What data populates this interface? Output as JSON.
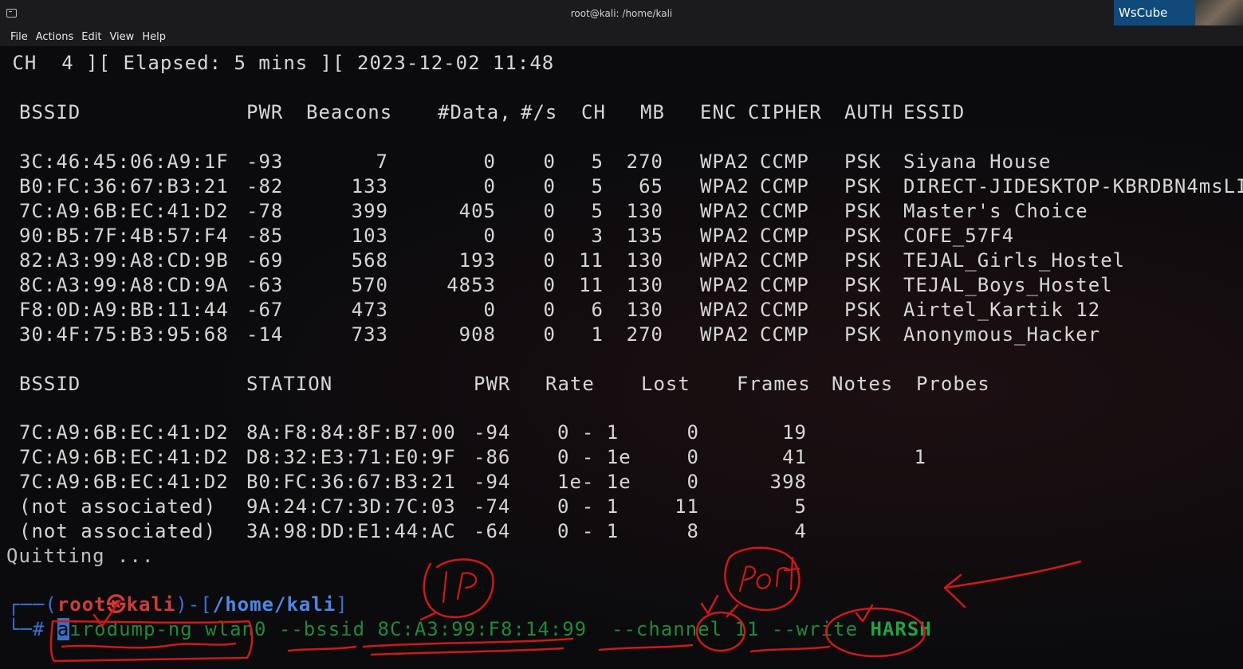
{
  "window": {
    "title": "root@kali: /home/kali",
    "brand": "WsCube Tech"
  },
  "menu": [
    "File",
    "Actions",
    "Edit",
    "View",
    "Help"
  ],
  "terminal": {
    "status_line": " CH  4 ][ Elapsed: 5 mins ][ 2023-12-02 11:48",
    "ap_headers": [
      "BSSID",
      "PWR",
      "Beacons",
      "#Data,",
      "#/s",
      "CH",
      "MB",
      "ENC",
      "CIPHER",
      "AUTH",
      "ESSID"
    ],
    "ap_rows": [
      [
        "3C:46:45:06:A9:1F",
        "-93",
        "7",
        "0",
        "0",
        "5",
        "270",
        "WPA2",
        "CCMP",
        "PSK",
        "Siyana House"
      ],
      [
        "B0:FC:36:67:B3:21",
        "-82",
        "133",
        "0",
        "0",
        "5",
        "65",
        "WPA2",
        "CCMP",
        "PSK",
        "DIRECT-JIDESKTOP-KBRDBN4msLI"
      ],
      [
        "7C:A9:6B:EC:41:D2",
        "-78",
        "399",
        "405",
        "0",
        "5",
        "130",
        "WPA2",
        "CCMP",
        "PSK",
        "Master's Choice"
      ],
      [
        "90:B5:7F:4B:57:F4",
        "-85",
        "103",
        "0",
        "0",
        "3",
        "135",
        "WPA2",
        "CCMP",
        "PSK",
        "COFE_57F4"
      ],
      [
        "82:A3:99:A8:CD:9B",
        "-69",
        "568",
        "193",
        "0",
        "11",
        "130",
        "WPA2",
        "CCMP",
        "PSK",
        "TEJAL_Girls_Hostel"
      ],
      [
        "8C:A3:99:A8:CD:9A",
        "-63",
        "570",
        "4853",
        "0",
        "11",
        "130",
        "WPA2",
        "CCMP",
        "PSK",
        "TEJAL_Boys_Hostel"
      ],
      [
        "F8:0D:A9:BB:11:44",
        "-67",
        "473",
        "0",
        "0",
        "6",
        "130",
        "WPA2",
        "CCMP",
        "PSK",
        "Airtel_Kartik 12"
      ],
      [
        "30:4F:75:B3:95:68",
        "-14",
        "733",
        "908",
        "0",
        "1",
        "270",
        "WPA2",
        "CCMP",
        "PSK",
        "Anonymous_Hacker"
      ]
    ],
    "sta_headers": [
      "BSSID",
      "STATION",
      "PWR",
      "Rate",
      "Lost",
      "Frames",
      "Notes",
      "Probes"
    ],
    "sta_rows": [
      [
        "7C:A9:6B:EC:41:D2",
        "8A:F8:84:8F:B7:00",
        "-94",
        "0 - 1",
        "0",
        "19",
        ""
      ],
      [
        "7C:A9:6B:EC:41:D2",
        "D8:32:E3:71:E0:9F",
        "-86",
        "0 - 1e",
        "0",
        "41",
        "1"
      ],
      [
        "7C:A9:6B:EC:41:D2",
        "B0:FC:36:67:B3:21",
        "-94",
        "1e- 1e",
        "0",
        "398",
        ""
      ],
      [
        "(not associated)",
        "9A:24:C7:3D:7C:03",
        "-74",
        "0 - 1",
        "11",
        "5",
        ""
      ],
      [
        "(not associated)",
        "3A:98:DD:E1:44:AC",
        "-64",
        "0 - 1",
        "8",
        "4",
        ""
      ]
    ],
    "quitting": "Quitting ...",
    "prompt": {
      "open": "┌──(",
      "user": "root㉿kali",
      "mid": ")-[",
      "path": "/home/kali",
      "close": "]",
      "corner": "└─",
      "hash": "#"
    },
    "command": {
      "cursor_char": "a",
      "text": "irodump-ng wlan0 --bssid 8C:A3:99:F8:14:99  --channel 11 --write ",
      "file": "HARSH"
    }
  },
  "annotations": {
    "ip_label": "IP",
    "port_label": "port",
    "ink_color": "#d01818"
  }
}
